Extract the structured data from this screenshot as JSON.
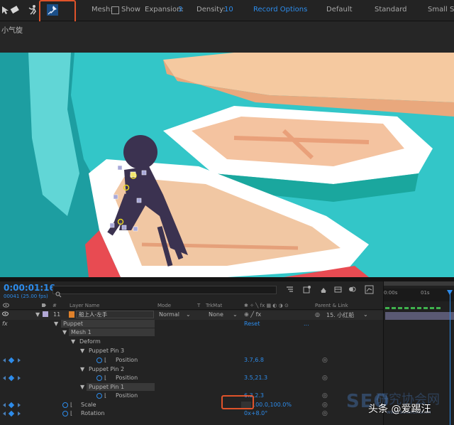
{
  "toolbar": {
    "mesh_label": "Mesh:",
    "show_label": "Show",
    "expansion_label": "Expansion:",
    "expansion_value": "3",
    "density_label": "Density:",
    "density_value": "10",
    "record_options": "Record Options",
    "presets": [
      "Default",
      "Standard",
      "Small Sc"
    ],
    "icons": [
      "hand-cursor-icon",
      "eraser-icon",
      "puppet-figure-icon",
      "puppet-pin-tool-icon"
    ]
  },
  "composition": {
    "name": "小气旋"
  },
  "timeline": {
    "timecode": "0:00:01:16",
    "frame_info": "00041 (25.00 fps)",
    "search_placeholder": "ρ·",
    "columns": {
      "layer_name": "Layer Name",
      "mode": "Mode",
      "t": "T",
      "trkmat": "TrkMat",
      "parent_link": "Parent & Link",
      "hash": "#"
    },
    "layer": {
      "index": "11",
      "name": "船上人-左手",
      "mode": "Normal",
      "trkmat": "None",
      "parent": "15. 小红船"
    },
    "rows": {
      "fx": "fx",
      "puppet": "Puppet",
      "reset": "Reset",
      "ellipsis": "...",
      "mesh1": "Mesh 1",
      "deform": "Deform",
      "pin3": "Puppet Pin 3",
      "pin3_position_label": "Position",
      "pin3_position_value": "3.7,6.8",
      "pin2": "Puppet Pin 2",
      "pin2_position_label": "Position",
      "pin2_position_value": "3.5,21.3",
      "pin1": "Puppet Pin 1",
      "pin1_position_label": "Position",
      "pin1_position_value": "6.3,2.3",
      "scale_label": "Scale",
      "scale_value": "100.0,100.0%",
      "rotation_label": "Rotation",
      "rotation_value": "0x+8.0°"
    },
    "ruler": {
      "start": "0:00s",
      "mark": "01s"
    }
  },
  "watermarks": {
    "seo": "SEO",
    "seo_zh": "研究协会网",
    "url": "www.seoxiehui.cn",
    "toutiao": "头条 @爱踢汪"
  },
  "colors": {
    "accent_blue": "#2d8ceb",
    "highlight_orange": "#e0532a",
    "scene_teal": "#2fc3c6",
    "boat_peach": "#f5c9a0"
  }
}
